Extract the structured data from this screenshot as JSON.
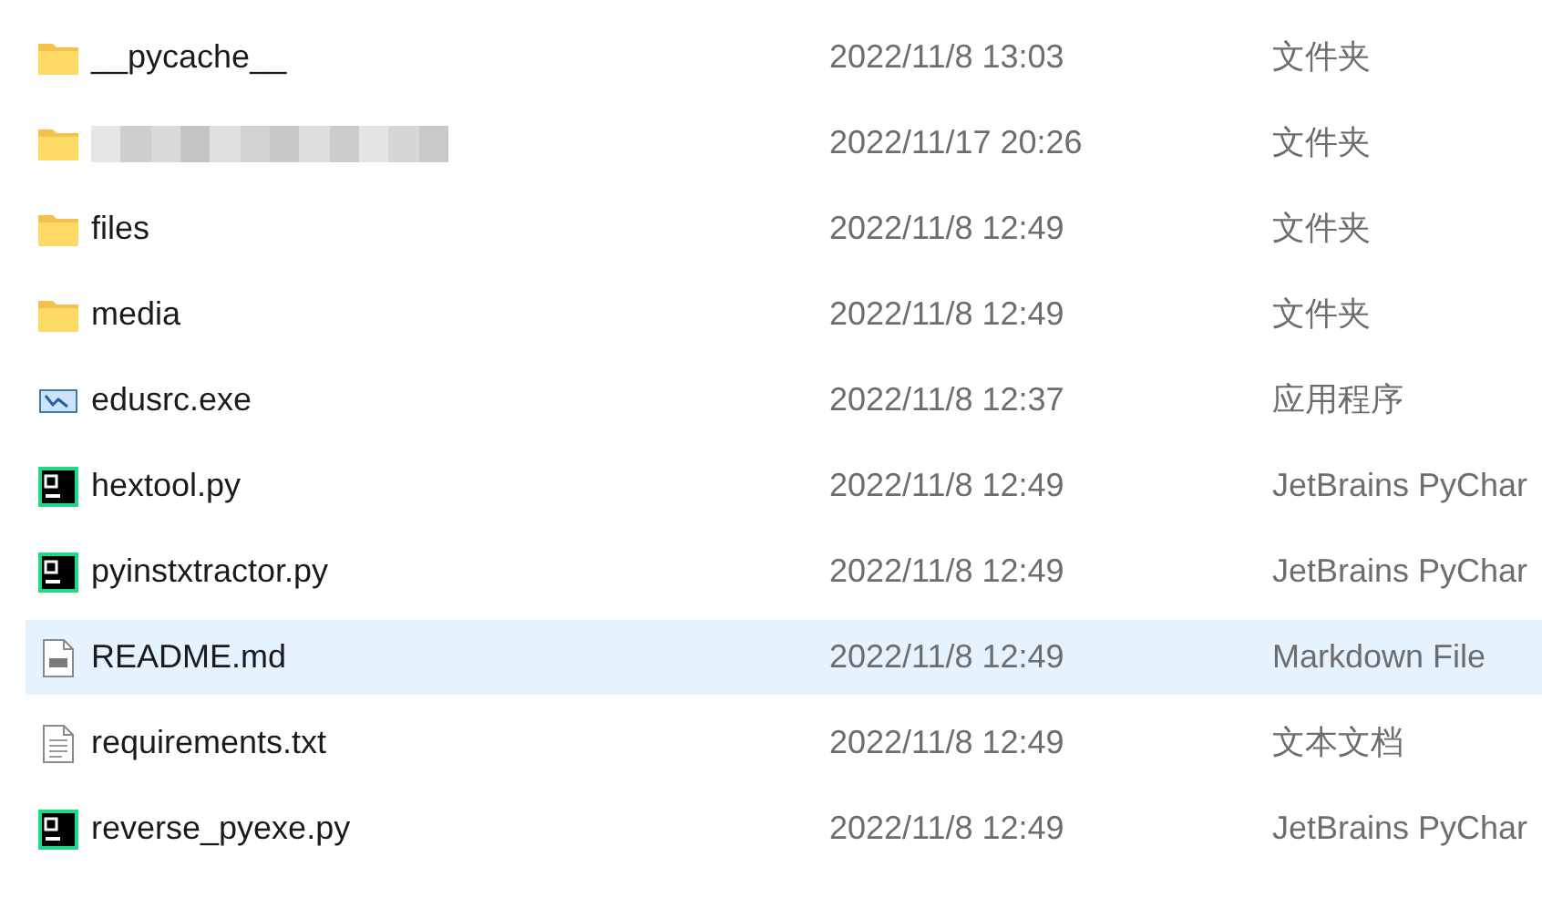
{
  "files": [
    {
      "kind": "folder",
      "name": "__pycache__",
      "blurred": false,
      "date": "2022/11/8 13:03",
      "type": "文件夹",
      "selected": false
    },
    {
      "kind": "folder",
      "blurred": true,
      "date": "2022/11/17 20:26",
      "type": "文件夹",
      "selected": false
    },
    {
      "kind": "folder",
      "name": "files",
      "blurred": false,
      "date": "2022/11/8 12:49",
      "type": "文件夹",
      "selected": false
    },
    {
      "kind": "folder",
      "name": "media",
      "blurred": false,
      "date": "2022/11/8 12:49",
      "type": "文件夹",
      "selected": false
    },
    {
      "kind": "exe",
      "name": "edusrc.exe",
      "blurred": false,
      "date": "2022/11/8 12:37",
      "type": "应用程序",
      "selected": false
    },
    {
      "kind": "python",
      "name": "hextool.py",
      "blurred": false,
      "date": "2022/11/8 12:49",
      "type": "JetBrains PyChar",
      "selected": false
    },
    {
      "kind": "python",
      "name": "pyinstxtractor.py",
      "blurred": false,
      "date": "2022/11/8 12:49",
      "type": "JetBrains PyChar",
      "selected": false
    },
    {
      "kind": "markdown",
      "name": "README.md",
      "blurred": false,
      "date": "2022/11/8 12:49",
      "type": "Markdown File",
      "selected": true
    },
    {
      "kind": "text",
      "name": "requirements.txt",
      "blurred": false,
      "date": "2022/11/8 12:49",
      "type": "文本文档",
      "selected": false
    },
    {
      "kind": "python",
      "name": "reverse_pyexe.py",
      "blurred": false,
      "date": "2022/11/8 12:49",
      "type": "JetBrains PyChar",
      "selected": false
    }
  ]
}
